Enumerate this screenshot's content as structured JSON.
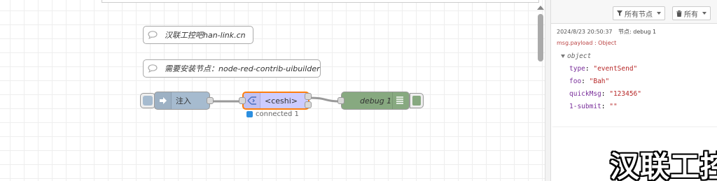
{
  "workspace": {
    "comments": [
      {
        "text": "汉联工控吧han-link.cn"
      },
      {
        "text": "需要安装节点：node-red-contrib-uibuilder"
      }
    ],
    "nodes": {
      "inject": {
        "label": "注入",
        "color": "#a6bbcf"
      },
      "ceshi": {
        "label": "<ceshi>",
        "color": "#ccccff",
        "status": "connected 1",
        "status_color": "#2c8fe0",
        "selected_border": "#ff7f0e"
      },
      "debug": {
        "label": "debug 1",
        "color": "#87a980"
      }
    }
  },
  "sidebar": {
    "filter_label": "所有节点",
    "clear_label": "所有",
    "message": {
      "timestamp": "2024/8/23 20:50:37",
      "node": "节点: debug 1",
      "topic": "msg.payload : Object",
      "type": "object",
      "props": [
        {
          "key": "type",
          "value": "\"eventSend\""
        },
        {
          "key": "foo",
          "value": "\"Bah\""
        },
        {
          "key": "quickMsg",
          "value": "\"123456\""
        },
        {
          "key": "1-submit",
          "value": "\"\""
        }
      ]
    }
  },
  "watermark": "汉联工控吧"
}
